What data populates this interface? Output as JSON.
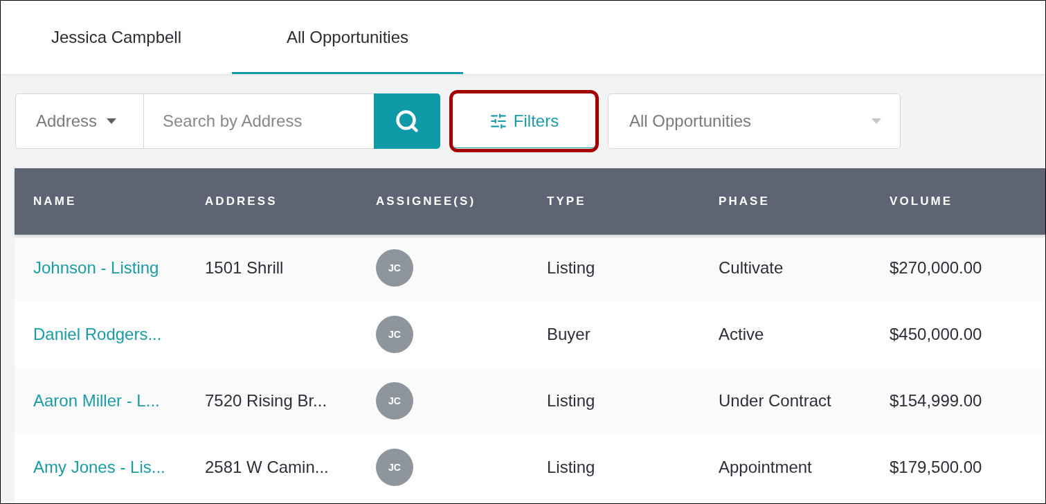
{
  "tabs": [
    {
      "label": "Jessica Campbell",
      "selected": false
    },
    {
      "label": "All Opportunities",
      "selected": true
    }
  ],
  "toolbar": {
    "search_type": {
      "value": "Address"
    },
    "search": {
      "placeholder": "Search by Address"
    },
    "filters": {
      "label": "Filters",
      "highlighted": true
    },
    "view_select": {
      "value": "All Opportunities"
    }
  },
  "table": {
    "columns": [
      "NAME",
      "ADDRESS",
      "ASSIGNEE(S)",
      "TYPE",
      "PHASE",
      "VOLUME"
    ],
    "rows": [
      {
        "name": "Johnson - Listing",
        "address": "1501 Shrill",
        "assignee": "JC",
        "type": "Listing",
        "phase": "Cultivate",
        "volume": "$270,000.00"
      },
      {
        "name": "Daniel Rodgers...",
        "assignee": "JC",
        "type": "Buyer",
        "phase": "Active",
        "volume": "$450,000.00"
      },
      {
        "name": "Aaron Miller - L...",
        "address": "7520 Rising Br...",
        "assignee": "JC",
        "type": "Listing",
        "phase": "Under Contract",
        "volume": "$154,999.00"
      },
      {
        "name": "Amy Jones - Lis...",
        "address": "2581 W Camin...",
        "assignee": "JC",
        "type": "Listing",
        "phase": "Appointment",
        "volume": "$179,500.00"
      }
    ]
  }
}
